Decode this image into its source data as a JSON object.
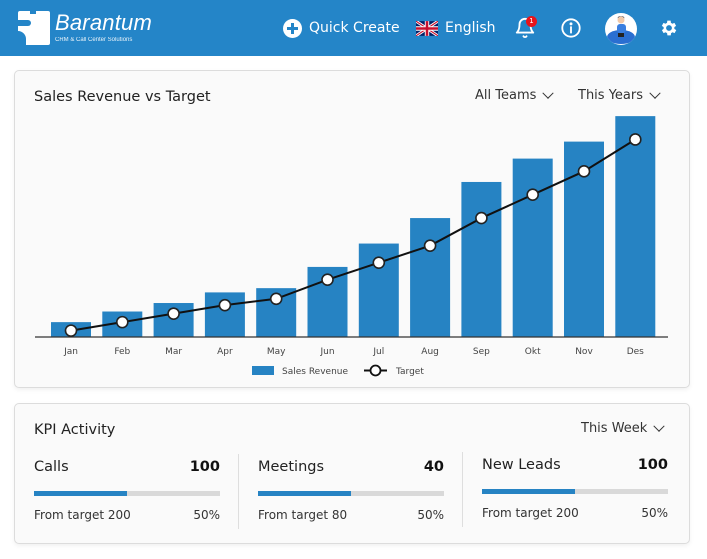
{
  "header": {
    "logo_name": "Barantum",
    "logo_tagline": "CRM & Call Center Solutions",
    "quick_create": "Quick Create",
    "language": "English",
    "notification_count": "1",
    "brand_color": "#2485c8",
    "icons": [
      "plus-circle-icon",
      "uk-flag-icon",
      "bell-icon",
      "info-icon",
      "avatar",
      "gear-icon"
    ]
  },
  "sales_card": {
    "title": "Sales Revenue vs Target",
    "team_filter": "All Teams",
    "period_filter": "This Years"
  },
  "chart_data": {
    "type": "bar",
    "title": "Sales Revenue vs Target",
    "categories": [
      "Jan",
      "Feb",
      "Mar",
      "Apr",
      "May",
      "Jun",
      "Jul",
      "Aug",
      "Sep",
      "Okt",
      "Nov",
      "Des"
    ],
    "series": [
      {
        "name": "Sales Revenue",
        "type": "bar",
        "color": "#2683c3",
        "values": [
          7,
          12,
          16,
          21,
          23,
          33,
          44,
          56,
          73,
          84,
          92,
          104
        ]
      },
      {
        "name": "Target",
        "type": "line",
        "color": "#111111",
        "values": [
          3,
          7,
          11,
          15,
          18,
          27,
          35,
          43,
          56,
          67,
          78,
          93
        ]
      }
    ],
    "xlabel": "",
    "ylabel": "",
    "ylim": [
      0,
      105
    ],
    "grid": false,
    "legend": "bottom-center"
  },
  "kpi_card": {
    "title": "KPI Activity",
    "period_filter": "This Week",
    "items": [
      {
        "label": "Calls",
        "value": "100",
        "target_text": "From target 200",
        "percent_text": "50%",
        "progress": 0.5
      },
      {
        "label": "Meetings",
        "value": "40",
        "target_text": "From target 80",
        "percent_text": "50%",
        "progress": 0.5
      },
      {
        "label": "New Leads",
        "value": "100",
        "target_text": "From target 200",
        "percent_text": "50%",
        "progress": 0.5
      }
    ]
  }
}
